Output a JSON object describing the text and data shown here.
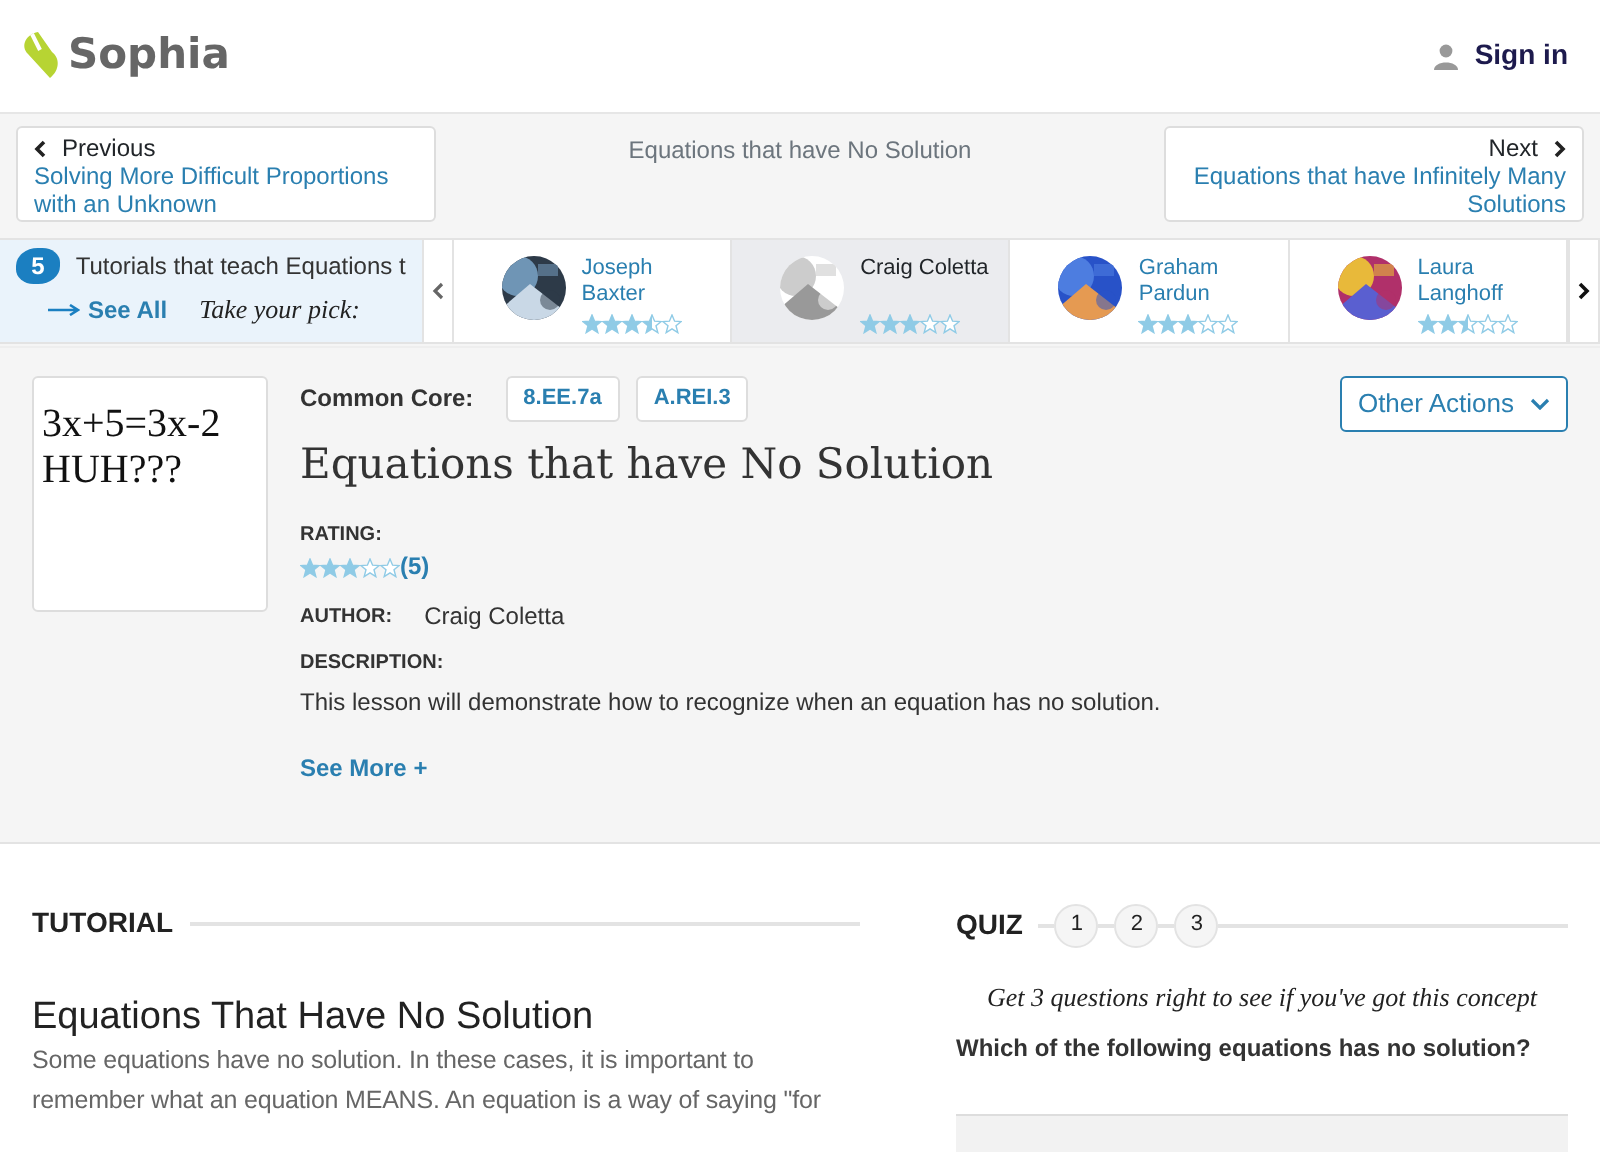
{
  "header": {
    "logo": "Sophia",
    "sign_in": "Sign in"
  },
  "lesson_nav": {
    "previous": {
      "label": "Previous",
      "title": "Solving More Difficult Proportions with an Unknown"
    },
    "current": "Equations that have No Solution",
    "next": {
      "label": "Next",
      "title": "Equations that have Infinitely Many Solutions"
    }
  },
  "tutorials": {
    "count": "5",
    "heading": "Tutorials that teach Equations t",
    "see_all": "See All",
    "tagline": "Take your pick:",
    "items": [
      {
        "author": "Joseph Baxter",
        "stars": 3.5,
        "selected": false
      },
      {
        "author": "Craig Coletta",
        "stars": 3,
        "selected": true
      },
      {
        "author": "Graham Pardun",
        "stars": 3,
        "selected": false
      },
      {
        "author": "Laura Langhoff",
        "stars": 2.5,
        "selected": false
      }
    ]
  },
  "lesson": {
    "thumbnail_lines": [
      "3x+5=3x-2",
      "HUH???"
    ],
    "common_core_label": "Common Core:",
    "standards": [
      "8.EE.7a",
      "A.REI.3"
    ],
    "actions": "Other Actions",
    "title": "Equations that have No Solution",
    "rating_label": "RATING:",
    "stars": 3,
    "rating_count": "(5)",
    "author_label": "AUTHOR:",
    "author": "Craig Coletta",
    "description_label": "DESCRIPTION:",
    "description": "This lesson will demonstrate how to recognize when an equation has no solution.",
    "see_more": "See More +"
  },
  "tutorial": {
    "heading": "TUTORIAL",
    "title": "Equations That Have No Solution",
    "body": "Some equations have no solution. In these cases, it is important to remember what an equation MEANS. An equation is a way of saying \"for"
  },
  "quiz": {
    "heading": "QUIZ",
    "steps": [
      "1",
      "2",
      "3"
    ],
    "tagline": "Get 3 questions right to see if you've got this concept",
    "question": "Which of the following equations has no solution?"
  }
}
